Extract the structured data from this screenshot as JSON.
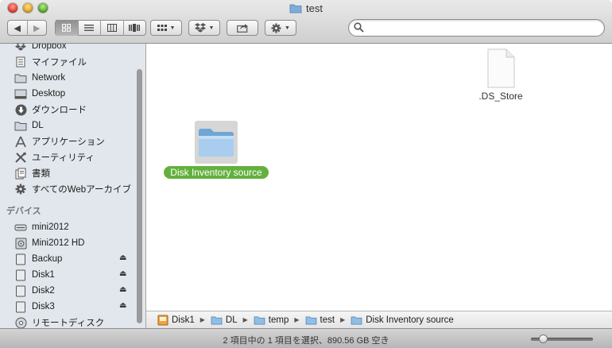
{
  "window": {
    "title": "test"
  },
  "toolbar": {
    "back_label": "◀",
    "forward_label": "▶",
    "search": {
      "value": "",
      "placeholder": ""
    }
  },
  "sidebar": {
    "favorites": [
      {
        "label": "Dropbox",
        "icon": "dropbox-icon"
      },
      {
        "label": "マイファイル",
        "icon": "all-files-icon"
      },
      {
        "label": "Network",
        "icon": "folder-icon"
      },
      {
        "label": "Desktop",
        "icon": "desktop-icon"
      },
      {
        "label": "ダウンロード",
        "icon": "download-icon"
      },
      {
        "label": "DL",
        "icon": "folder-icon"
      },
      {
        "label": "アプリケーション",
        "icon": "applications-icon"
      },
      {
        "label": "ユーティリティ",
        "icon": "utilities-icon"
      },
      {
        "label": "書類",
        "icon": "documents-icon"
      },
      {
        "label": "すべてのWebアーカイブ",
        "icon": "gear-icon"
      }
    ],
    "devices_header": "デバイス",
    "devices": [
      {
        "label": "mini2012",
        "icon": "drive-icon",
        "eject": false
      },
      {
        "label": "Mini2012 HD",
        "icon": "hd-icon",
        "eject": false
      },
      {
        "label": "Backup",
        "icon": "disk-icon",
        "eject": true
      },
      {
        "label": "Disk1",
        "icon": "disk-icon",
        "eject": true
      },
      {
        "label": "Disk2",
        "icon": "disk-icon",
        "eject": true
      },
      {
        "label": "Disk3",
        "icon": "disk-icon",
        "eject": true
      },
      {
        "label": "リモートディスク",
        "icon": "remote-disc-icon",
        "eject": false
      }
    ]
  },
  "content": {
    "files": [
      {
        "name": ".DS_Store",
        "kind": "document"
      },
      {
        "name": "Disk Inventory source",
        "kind": "folder",
        "selected": true
      }
    ]
  },
  "pathbar": {
    "crumbs": [
      "Disk1",
      "DL",
      "temp",
      "test",
      "Disk Inventory source"
    ]
  },
  "status": {
    "text": "2 項目中の 1 項目を選択、890.56 GB 空き"
  },
  "zoom_slider": {
    "value": 0.15
  },
  "colors": {
    "selection": "#62b13e",
    "folder": "#8fbfe6",
    "sidebar_bg": "#e2e7ed"
  }
}
